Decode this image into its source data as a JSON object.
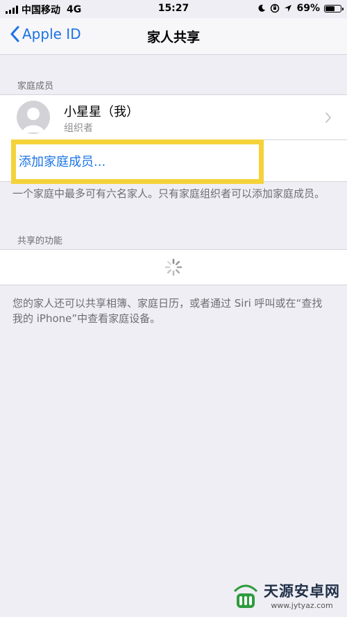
{
  "status_bar": {
    "carrier": "中国移动",
    "network": "4G",
    "time": "15:27",
    "battery_percent": "69%",
    "battery_level": 0.69,
    "icons": [
      "signal-icon",
      "moon-icon",
      "orientation-lock-icon",
      "location-icon",
      "battery-icon"
    ]
  },
  "nav": {
    "back_label": "Apple ID",
    "title": "家人共享"
  },
  "family_section": {
    "header": "家庭成员",
    "member": {
      "name": "小星星（我）",
      "role": "组织者"
    },
    "add_member_label": "添加家庭成员...",
    "footer": "一个家庭中最多可有六名家人。只有家庭组织者可以添加家庭成员。"
  },
  "shared_section": {
    "header": "共享的功能",
    "footer": "您的家人还可以共享相簿、家庭日历，或者通过 Siri 呼叫或在“查找我的 iPhone”中查看家庭设备。"
  },
  "watermark": {
    "title": "天源安卓网",
    "url": "www.jytyaz.com"
  },
  "colors": {
    "accent": "#1b73e3",
    "highlight": "#f5d23a",
    "background": "#efeef4"
  }
}
